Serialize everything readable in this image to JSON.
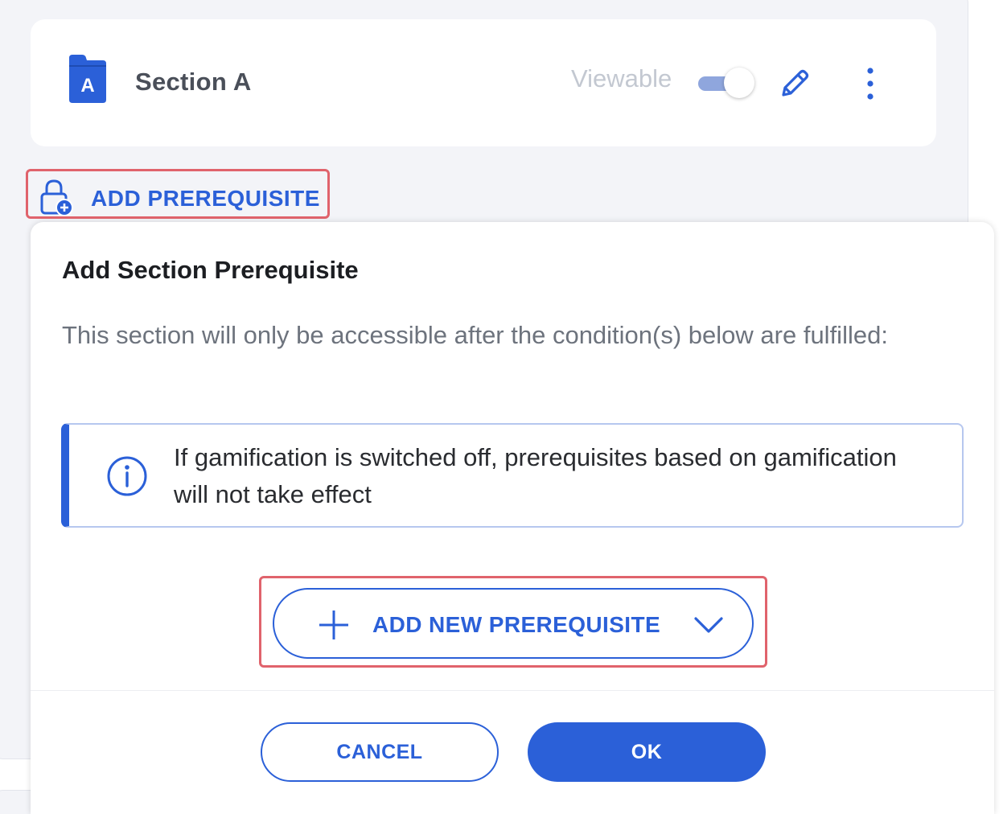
{
  "section": {
    "icon": "folder-icon",
    "icon_letter": "A",
    "title": "Section A",
    "viewable_label": "Viewable",
    "viewable_on": true,
    "edit_icon": "pencil-icon",
    "more_icon": "more-vertical-icon"
  },
  "add_prerequisite": {
    "icon": "lock-add-icon",
    "label": "ADD PREREQUISITE"
  },
  "dialog": {
    "title": "Add Section Prerequisite",
    "description": "This section will only be accessible after the condition(s) below are fulfilled:",
    "info": {
      "icon": "info-icon",
      "text": "If gamification is switched off, prerequisites based on gamification will not take effect"
    },
    "add_new": {
      "icon": "plus-icon",
      "label": "ADD NEW PREREQUISITE",
      "dropdown_icon": "chevron-down-icon"
    },
    "cancel_label": "CANCEL",
    "ok_label": "OK"
  },
  "colors": {
    "primary": "#2b60d8",
    "highlight_outline": "#e0636c",
    "background": "#f3f4f8",
    "title_text": "#4a4f59",
    "muted_text": "#6d737d"
  }
}
